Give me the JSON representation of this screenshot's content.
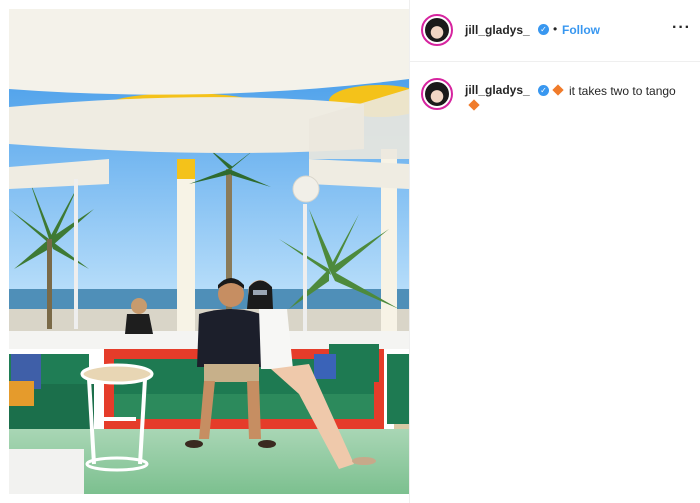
{
  "header": {
    "username": "jill_gladys_",
    "follow_label": "Follow",
    "separator": "•",
    "more_label": "···"
  },
  "caption": {
    "username": "jill_gladys_",
    "text": "it takes two to tango"
  },
  "colors": {
    "accent": "#3897f0",
    "emoji_orange": "#f07b2a",
    "ring": "#d6249f"
  },
  "icons": {
    "verified": "verified-badge-icon",
    "emoji": "orange-diamond-icon",
    "more": "more-options-icon"
  }
}
